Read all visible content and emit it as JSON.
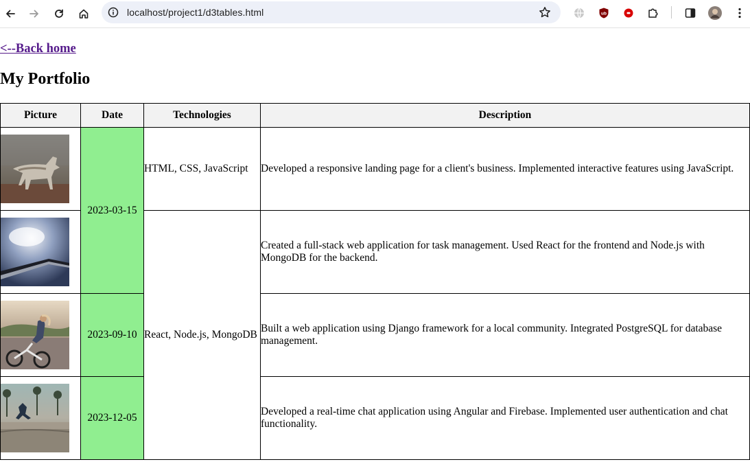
{
  "browser": {
    "url": "localhost/project1/d3tables.html"
  },
  "page": {
    "back_link": "<--Back home",
    "title": "My Portfolio"
  },
  "table": {
    "headers": [
      "Picture",
      "Date",
      "Technologies",
      "Description"
    ],
    "dates": [
      "2023-03-15",
      "2023-09-10",
      "2023-12-05"
    ],
    "technologies": [
      "HTML, CSS, JavaScript",
      "React, Node.js, MongoDB"
    ],
    "rows": [
      {
        "picture": "wolf-photo",
        "description": "Developed a responsive landing page for a client's business. Implemented interactive features using JavaScript."
      },
      {
        "picture": "phone-closeup-photo",
        "description": "Created a full-stack web application for task management. Used React for the frontend and Node.js with MongoDB for the backend."
      },
      {
        "picture": "cyclist-photo",
        "description": "Built a web application using Django framework for a local community. Integrated PostgreSQL for database management."
      },
      {
        "picture": "skatepark-photo",
        "description": "Developed a real-time chat application using Angular and Firebase. Implemented user authentication and chat functionality."
      }
    ]
  },
  "colors": {
    "date_highlight": "#90ee90",
    "header_bg": "#f2f2f2",
    "link_visited": "#551a8b",
    "omnibox_bg": "#edf0f8"
  },
  "icons": {
    "toolbar": [
      "back-arrow-icon",
      "forward-arrow-icon",
      "reload-icon",
      "home-icon",
      "site-info-icon",
      "bookmark-star-icon",
      "globe-extension-icon",
      "ublock-shield-icon",
      "record-extension-icon",
      "extensions-puzzle-icon",
      "side-panel-icon",
      "profile-avatar",
      "kebab-menu-icon"
    ]
  }
}
